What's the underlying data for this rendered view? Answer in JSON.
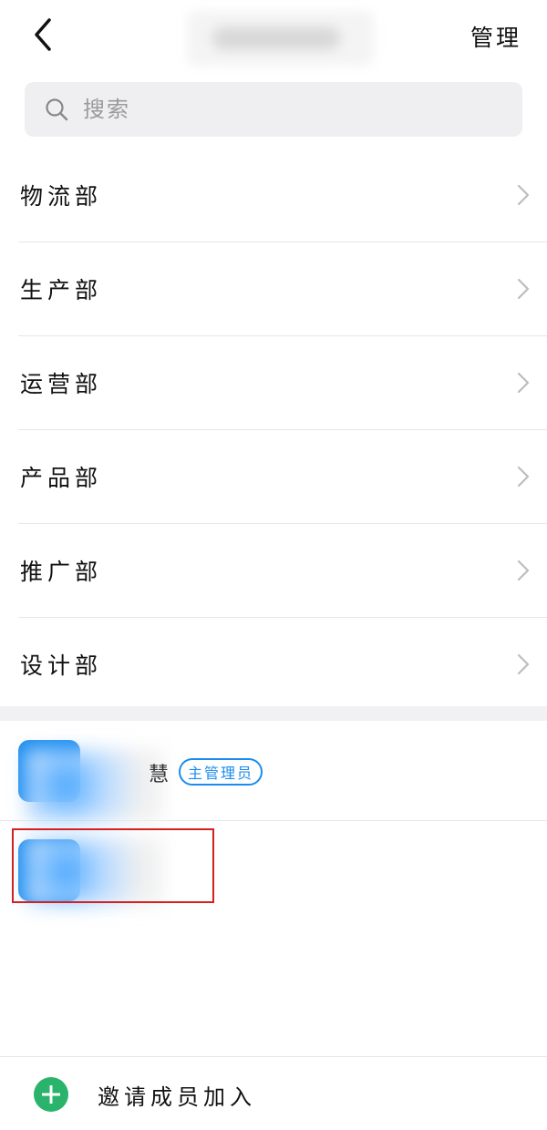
{
  "header": {
    "back_icon": "chevron-left-icon",
    "manage_label": "管理"
  },
  "search": {
    "placeholder": "搜索",
    "icon": "search-icon"
  },
  "departments": [
    {
      "label": "物流部"
    },
    {
      "label": "生产部"
    },
    {
      "label": "运营部"
    },
    {
      "label": "产品部"
    },
    {
      "label": "推广部"
    },
    {
      "label": "设计部"
    }
  ],
  "members": [
    {
      "name_visible_fragment": "慧",
      "badge": "主管理员"
    },
    {
      "name_visible_fragment": "",
      "badge": ""
    }
  ],
  "footer": {
    "invite_label": "邀请成员加入",
    "invite_icon": "plus-circle-icon"
  },
  "colors": {
    "accent": "#1a8cf0",
    "invite_green": "#29b36b",
    "highlight_red": "#d32020",
    "search_bg": "#efeff1"
  }
}
